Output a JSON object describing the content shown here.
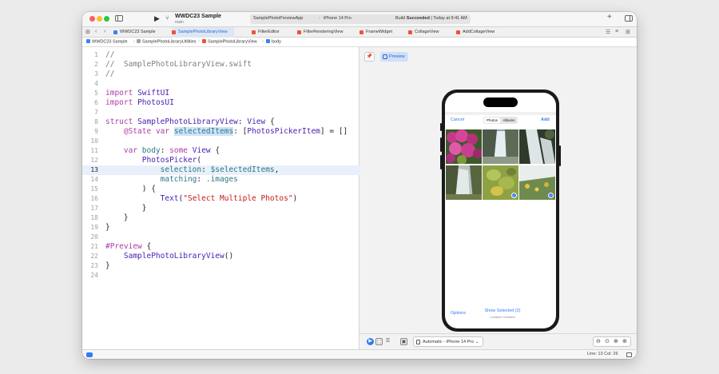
{
  "toolbar": {
    "project_name": "WWDC23 Sample",
    "branch": "main",
    "scheme_app": "SamplePhotoPreviewApp",
    "scheme_device": "iPhone 14 Pro",
    "build_status_prefix": "Build",
    "build_status_word": "Succeeded",
    "build_status_suffix": "| Today at 9:41 AM"
  },
  "tabs": [
    {
      "label": "WWDC23 Sample"
    },
    {
      "label": "SamplePhotoLibraryView"
    },
    {
      "label": "FilterEditor"
    },
    {
      "label": "FilterRenderingView"
    },
    {
      "label": "FrameWidget"
    },
    {
      "label": "CollageView"
    },
    {
      "label": "AddCollageView"
    }
  ],
  "breadcrumb": [
    "WWDC23 Sample",
    "SamplePhotoLibraryUtilities",
    "SamplePhotoLibraryView",
    "body"
  ],
  "editor": {
    "current_line": 13,
    "lines": [
      {
        "n": "1",
        "t": "//"
      },
      {
        "n": "2",
        "t": "//  SamplePhotoLibraryView.swift"
      },
      {
        "n": "3",
        "t": "//"
      },
      {
        "n": "4",
        "t": ""
      },
      {
        "n": "5",
        "t": "import SwiftUI"
      },
      {
        "n": "6",
        "t": "import PhotosUI"
      },
      {
        "n": "7",
        "t": ""
      },
      {
        "n": "8",
        "t": "struct SamplePhotoLibraryView: View {"
      },
      {
        "n": "9",
        "t": "    @State var selectedItems: [PhotosPickerItem] = []"
      },
      {
        "n": "10",
        "t": ""
      },
      {
        "n": "11",
        "t": "    var body: some View {"
      },
      {
        "n": "12",
        "t": "        PhotosPicker("
      },
      {
        "n": "13",
        "t": "            selection: $selectedItems,"
      },
      {
        "n": "14",
        "t": "            matching: .images"
      },
      {
        "n": "15",
        "t": "        ) {"
      },
      {
        "n": "16",
        "t": "            Text(\"Select Multiple Photos\")"
      },
      {
        "n": "17",
        "t": "        }"
      },
      {
        "n": "18",
        "t": "    }"
      },
      {
        "n": "19",
        "t": "}"
      },
      {
        "n": "20",
        "t": ""
      },
      {
        "n": "21",
        "t": "#Preview {"
      },
      {
        "n": "22",
        "t": "    SamplePhotoLibraryView()"
      },
      {
        "n": "23",
        "t": "}"
      },
      {
        "n": "24",
        "t": ""
      }
    ]
  },
  "canvas": {
    "preview_label": "Preview",
    "device_label": "Automatic - iPhone 14 Pro"
  },
  "picker": {
    "cancel": "Cancel",
    "add": "Add",
    "segment_photos": "Photos",
    "segment_albums": "Albums",
    "options": "Options",
    "show_selected": "Show Selected (2)",
    "location_note": "Location Included",
    "selected_photos": [
      5,
      6
    ]
  },
  "statusbar": {
    "position": "Line: 13  Col: 26"
  },
  "colors": {
    "accent": "#2f7cf6",
    "keyword": "#ad3da4",
    "type": "#4b21b0",
    "string": "#c41a16",
    "comment": "#7a7f86"
  }
}
